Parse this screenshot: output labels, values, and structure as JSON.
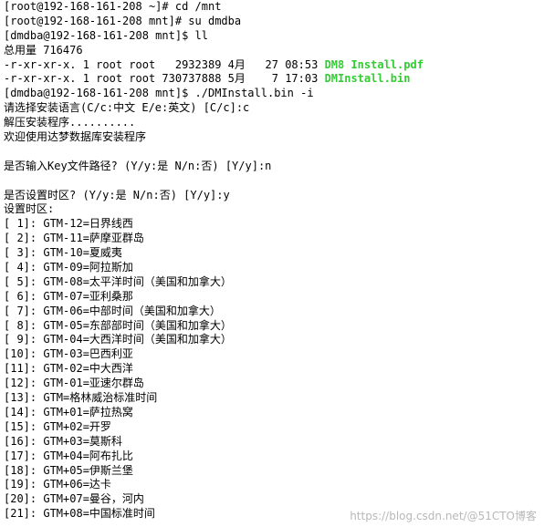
{
  "terminal": {
    "lines": [
      "[root@192-168-161-208 ~]# cd /mnt",
      "[root@192-168-161-208 mnt]# su dmdba",
      "[dmdba@192-168-161-208 mnt]$ ll",
      "总用量 716476",
      {
        "prefix": "-r-xr-xr-x. 1 root root   2932389 4月   27 08:53 ",
        "highlight": "DM8 Install.pdf"
      },
      {
        "prefix": "-r-xr-xr-x. 1 root root 730737888 5月    7 17:03 ",
        "highlight": "DMInstall.bin"
      },
      "[dmdba@192-168-161-208 mnt]$ ./DMInstall.bin -i",
      "请选择安装语言(C/c:中文 E/e:英文) [C/c]:c",
      "解压安装程序..........",
      "欢迎使用达梦数据库安装程序",
      "",
      "是否输入Key文件路径? (Y/y:是 N/n:否) [Y/y]:n",
      "",
      "是否设置时区? (Y/y:是 N/n:否) [Y/y]:y",
      "设置时区:",
      "[ 1]: GTM-12=日界线西",
      "[ 2]: GTM-11=萨摩亚群岛",
      "[ 3]: GTM-10=夏威夷",
      "[ 4]: GTM-09=阿拉斯加",
      "[ 5]: GTM-08=太平洋时间（美国和加拿大）",
      "[ 6]: GTM-07=亚利桑那",
      "[ 7]: GTM-06=中部时间（美国和加拿大）",
      "[ 8]: GTM-05=东部部时间（美国和加拿大）",
      "[ 9]: GTM-04=大西洋时间（美国和加拿大）",
      "[10]: GTM-03=巴西利亚",
      "[11]: GTM-02=中大西洋",
      "[12]: GTM-01=亚速尔群岛",
      "[13]: GTM=格林威治标准时间",
      "[14]: GTM+01=萨拉热窝",
      "[15]: GTM+02=开罗",
      "[16]: GTM+03=莫斯科",
      "[17]: GTM+04=阿布扎比",
      "[18]: GTM+05=伊斯兰堡",
      "[19]: GTM+06=达卡",
      "[20]: GTM+07=曼谷，河内",
      "[21]: GTM+08=中国标准时间"
    ],
    "highlight_color": "#33cc33"
  },
  "watermark": "https://blog.csdn.net/@51CTO博客"
}
